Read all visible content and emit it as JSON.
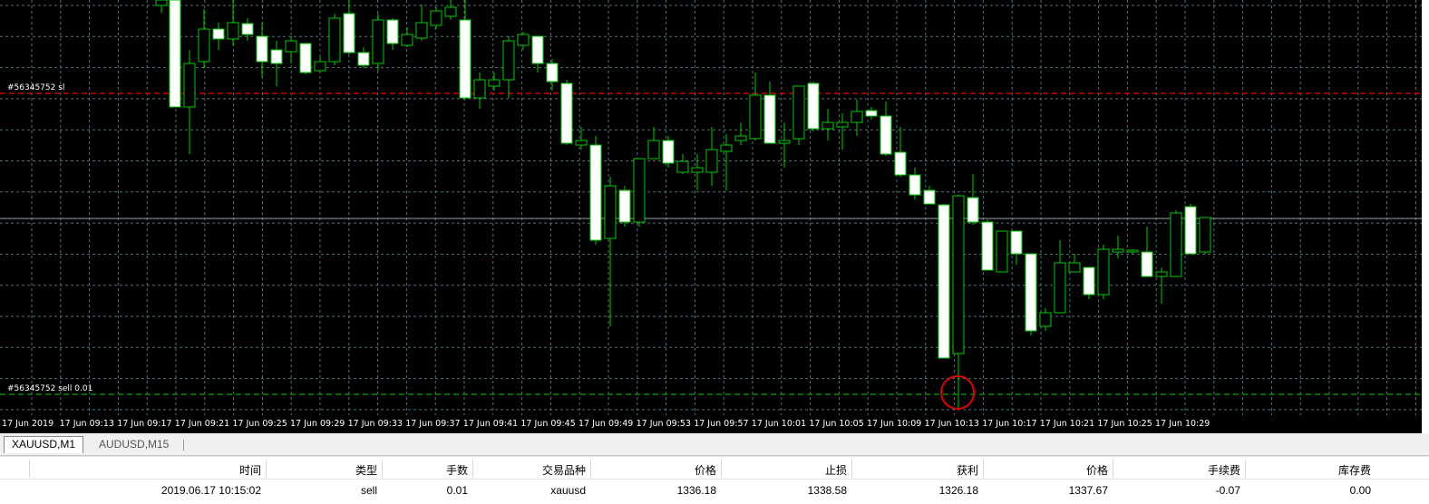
{
  "chart": {
    "symbol": "XAUUSD,M1",
    "sl_line_label": "#56345752 sl",
    "order_line_label": "#56345752 sell 0.01",
    "colors": {
      "background": "#000000",
      "grid": "#5a6e78",
      "bull_candle": "#000000",
      "bear_candle": "#ffffff",
      "wick": "#00cc00",
      "sl_line": "#cc0000",
      "order_line": "#00aa00",
      "highlight_circle": "#e00000"
    },
    "time_labels": [
      "17 Jun 2019",
      "17 Jun 09:13",
      "17 Jun 09:17",
      "17 Jun 09:21",
      "17 Jun 09:25",
      "17 Jun 09:29",
      "17 Jun 09:33",
      "17 Jun 09:37",
      "17 Jun 09:41",
      "17 Jun 09:45",
      "17 Jun 09:49",
      "17 Jun 09:53",
      "17 Jun 09:57",
      "17 Jun 10:01",
      "17 Jun 10:05",
      "17 Jun 10:09",
      "17 Jun 10:13",
      "17 Jun 10:17",
      "17 Jun 10:21",
      "17 Jun 10:25",
      "17 Jun 10:29"
    ]
  },
  "tabs": [
    {
      "label": "XAUUSD,M1",
      "active": true
    },
    {
      "label": "AUDUSD,M15",
      "active": false
    }
  ],
  "table": {
    "headers": [
      "时间",
      "类型",
      "手数",
      "交易品种",
      "价格",
      "止损",
      "获利",
      "价格",
      "手续费",
      "库存费"
    ],
    "rows": [
      [
        "2019.06.17 10:15:02",
        "sell",
        "0.01",
        "xauusd",
        "1336.18",
        "1338.58",
        "1326.18",
        "1337.67",
        "-0.07",
        "0.00"
      ]
    ]
  }
}
